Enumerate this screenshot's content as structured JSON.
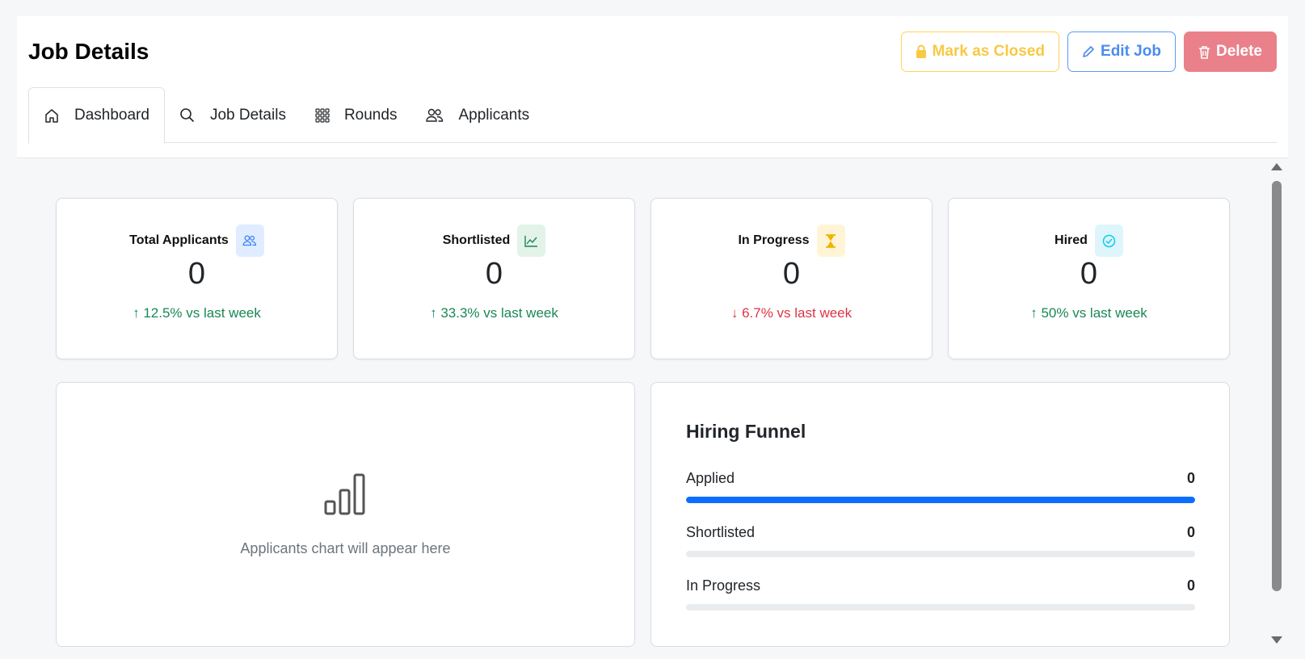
{
  "header": {
    "title": "Job Details",
    "actions": {
      "mark_closed": "Mark as Closed",
      "edit": "Edit Job",
      "delete": "Delete"
    },
    "tabs": [
      {
        "label": "Dashboard",
        "icon": "home-icon",
        "active": true
      },
      {
        "label": "Job Details",
        "icon": "search-icon",
        "active": false
      },
      {
        "label": "Rounds",
        "icon": "grid-icon",
        "active": false
      },
      {
        "label": "Applicants",
        "icon": "people-icon",
        "active": false
      }
    ]
  },
  "stats": [
    {
      "label": "Total Applicants",
      "value": "0",
      "trend": "↑ 12.5% vs last week",
      "direction": "up",
      "icon": "people-icon",
      "icon_bg": "#e0ecff",
      "icon_color": "#3b82f6"
    },
    {
      "label": "Shortlisted",
      "value": "0",
      "trend": "↑ 33.3% vs last week",
      "direction": "up",
      "icon": "line-chart-icon",
      "icon_bg": "#e3f3ea",
      "icon_color": "#198754"
    },
    {
      "label": "In Progress",
      "value": "0",
      "trend": "↓ 6.7% vs last week",
      "direction": "down",
      "icon": "hourglass-icon",
      "icon_bg": "#fff5d6",
      "icon_color": "#f0b400"
    },
    {
      "label": "Hired",
      "value": "0",
      "trend": "↑ 50% vs last week",
      "direction": "up",
      "icon": "check-circle-icon",
      "icon_bg": "#def6fb",
      "icon_color": "#0dcaf0"
    }
  ],
  "chart_placeholder": {
    "icon": "bar-chart-icon",
    "text": "Applicants chart will appear here"
  },
  "funnel": {
    "title": "Hiring Funnel",
    "rows": [
      {
        "label": "Applied",
        "count": "0",
        "fill": 1.0
      },
      {
        "label": "Shortlisted",
        "count": "0",
        "fill": 0.0
      },
      {
        "label": "In Progress",
        "count": "0",
        "fill": 0.0
      }
    ]
  },
  "colors": {
    "accent": "#0d6efd",
    "success": "#198754",
    "danger": "#dc3545",
    "warning": "#f7c944"
  }
}
